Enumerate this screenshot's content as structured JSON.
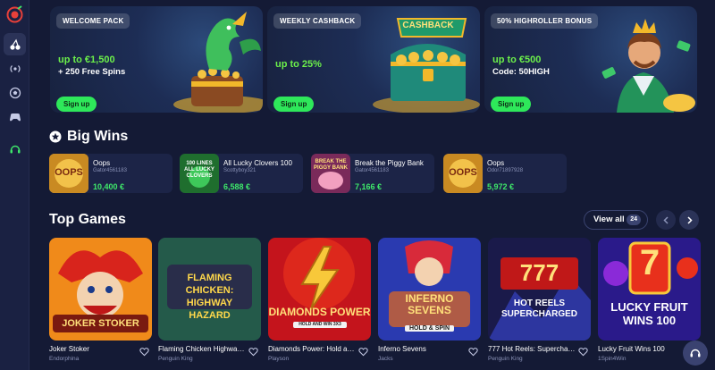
{
  "colors": {
    "bg": "#141a35",
    "accent_green": "#2ee85a",
    "amount_green": "#3ee86a",
    "card": "#1c2447"
  },
  "sidebar": {
    "items": [
      {
        "icon": "logo-icon"
      },
      {
        "icon": "cherries-icon",
        "active": true
      },
      {
        "icon": "live-broadcast-icon"
      },
      {
        "icon": "football-icon"
      },
      {
        "icon": "gamepad-icon"
      },
      {
        "icon": "headset-icon"
      }
    ]
  },
  "promos": [
    {
      "tag": "WELCOME PACK",
      "line1": "up to €1,500",
      "line2": "+ 250 Free Spins",
      "button": "Sign up",
      "art": "dragon-treasure"
    },
    {
      "tag": "WEEKLY CASHBACK",
      "line1": "up to 25%",
      "line2": "",
      "button": "Sign up",
      "art": "cashback-chest",
      "art_text": "CASHBACK"
    },
    {
      "tag": "50% HIGHROLLER BONUS",
      "line1": "up to €500",
      "line2": "Code: 50HIGH",
      "button": "Sign up",
      "art": "king-character"
    }
  ],
  "big_wins": {
    "title": "Big Wins",
    "items": [
      {
        "game": "Oops",
        "user": "Gator4561183",
        "amount": "10,400 €",
        "thumb_text": "OOPS"
      },
      {
        "game": "All Lucky Clovers 100",
        "user": "Scottyboy321",
        "amount": "6,588 €",
        "thumb_text": "100 LINES ALL LUCKY CLOVERS"
      },
      {
        "game": "Break the Piggy Bank",
        "user": "Gator4561183",
        "amount": "7,166 €",
        "thumb_text": "BREAK THE PIGGY BANK"
      },
      {
        "game": "Oops",
        "user": "Odor71897928",
        "amount": "5,972 €",
        "thumb_text": "OOPS"
      }
    ]
  },
  "top_games": {
    "title": "Top Games",
    "view_all": "View all",
    "count": "24",
    "games": [
      {
        "name": "Joker Stoker",
        "provider": "Endorphina",
        "cover_text": "JOKER STOKER"
      },
      {
        "name": "Flaming Chicken Highway Hazard",
        "provider": "Penguin King",
        "cover_text": "FLAMING CHICKEN: HIGHWAY HAZARD"
      },
      {
        "name": "Diamonds Power: Hold and Win",
        "provider": "Playson",
        "cover_text": "DIAMONDS POWER",
        "cover_sub": "HOLD AND WIN 3X3"
      },
      {
        "name": "Inferno Sevens",
        "provider": "Jacks",
        "cover_text": "INFERNO SEVENS",
        "cover_sub": "HOLD & SPIN"
      },
      {
        "name": "777 Hot Reels: Supercharged",
        "provider": "Penguin King",
        "cover_text": "HOT REELS SUPERCHARGED"
      },
      {
        "name": "Lucky Fruit Wins 100",
        "provider": "1Spin4Win",
        "cover_text": "LUCKY FRUIT WINS 100"
      }
    ]
  },
  "support": {
    "icon": "headset-icon"
  }
}
